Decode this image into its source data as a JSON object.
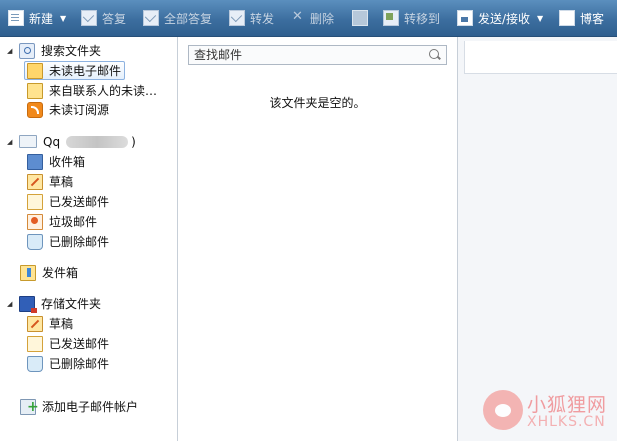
{
  "toolbar": {
    "new": "新建",
    "reply": "答复",
    "reply_all": "全部答复",
    "forward": "转发",
    "delete": "删除",
    "print": "",
    "move_to": "转移到",
    "send_receive": "发送/接收",
    "blog": "博客"
  },
  "folders": {
    "search_group": "搜索文件夹",
    "unread_mail": "未读电子邮件",
    "from_contacts": "来自联系人的未读…",
    "unread_feeds": "未读订阅源",
    "account_prefix": "Qq",
    "account_suffix": ")",
    "inbox": "收件箱",
    "drafts": "草稿",
    "sent": "已发送邮件",
    "junk": "垃圾邮件",
    "deleted": "已删除邮件",
    "outbox": "发件箱",
    "storage_group": "存储文件夹",
    "storage_drafts": "草稿",
    "storage_sent": "已发送邮件",
    "storage_deleted": "已删除邮件",
    "add_account": "添加电子邮件帐户"
  },
  "message_list": {
    "search_placeholder": "查找邮件",
    "empty_text": "该文件夹是空的。"
  },
  "watermark": {
    "cn": "小狐狸网",
    "en": "XHLKS.CN"
  }
}
